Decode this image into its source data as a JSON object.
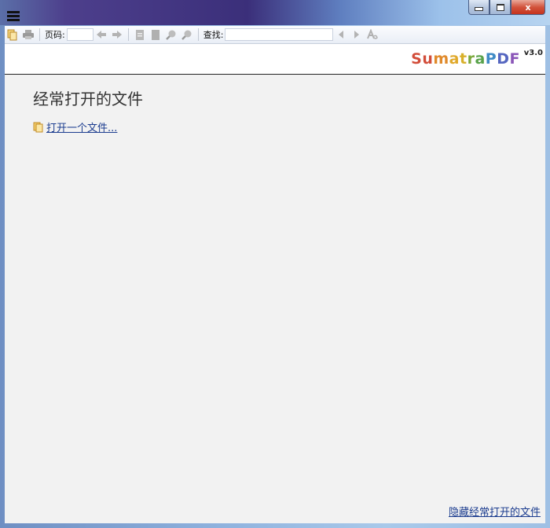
{
  "window": {
    "controls": {
      "close_glyph": "x"
    }
  },
  "toolbar": {
    "page_label": "页码:",
    "page_value": "",
    "find_label": "查找:",
    "find_value": ""
  },
  "logo": {
    "letters": [
      {
        "char": "S",
        "color": "#d24d3a"
      },
      {
        "char": "u",
        "color": "#d24d3a"
      },
      {
        "char": "m",
        "color": "#e08a2b"
      },
      {
        "char": "a",
        "color": "#e0a92b"
      },
      {
        "char": "t",
        "color": "#d8b02a"
      },
      {
        "char": "r",
        "color": "#7aa83b"
      },
      {
        "char": "a",
        "color": "#58a24a"
      },
      {
        "char": "P",
        "color": "#3f8bc6"
      },
      {
        "char": "D",
        "color": "#5566c0"
      },
      {
        "char": "F",
        "color": "#8a55b8"
      }
    ],
    "version": "v3.0"
  },
  "home": {
    "title": "经常打开的文件",
    "open_file_link": "打开一个文件...",
    "hide_link": "隐藏经常打开的文件"
  },
  "colors": {
    "link": "#1b3c8f",
    "content_bg": "#f2f2f2"
  }
}
